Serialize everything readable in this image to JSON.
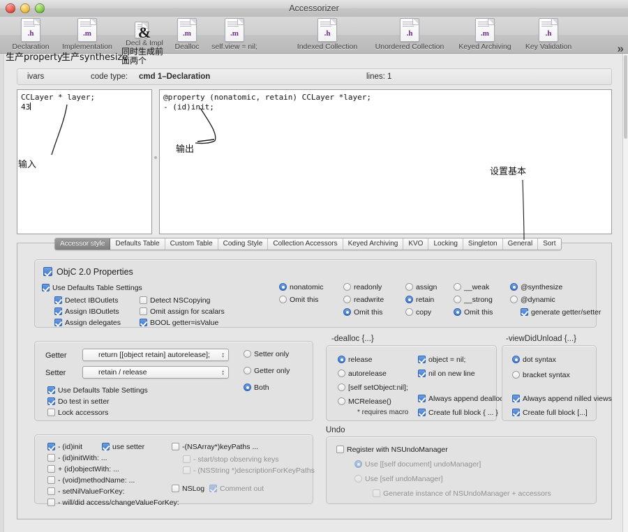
{
  "window": {
    "title": "Accessorizer",
    "traffic_lights": [
      "close",
      "minimize",
      "zoom"
    ]
  },
  "toolbar": {
    "overflow_label": "»",
    "items": [
      {
        "label": "Declaration",
        "icon": "h-file-icon",
        "ext": ".h"
      },
      {
        "label": "Implementation",
        "icon": "m-file-icon",
        "ext": ".m"
      },
      {
        "label": "Decl & Impl",
        "icon": "decl-impl-icon",
        "ext": "&"
      },
      {
        "label": "Dealloc",
        "icon": "m-file-icon",
        "ext": ".m"
      },
      {
        "label": "self.view = nil;",
        "icon": "m-file-icon",
        "ext": ".m"
      },
      {
        "label": "Indexed Collection",
        "icon": "h-file-icon",
        "ext": ".h"
      },
      {
        "label": "Unordered Collection",
        "icon": "h-file-icon",
        "ext": ".h"
      },
      {
        "label": "Keyed Archiving",
        "icon": "m-file-icon",
        "ext": ".m"
      },
      {
        "label": "Key Validation",
        "icon": "h-file-icon",
        "ext": ".h"
      }
    ]
  },
  "annotations": [
    {
      "text": "生产property"
    },
    {
      "text": "生产synthesize"
    },
    {
      "text": "同时生成前\n面两个"
    },
    {
      "text": "输入"
    },
    {
      "text": "输出"
    },
    {
      "text": "设置基本"
    }
  ],
  "infobar": {
    "ivars": "ivars",
    "code_type_label": "code type:",
    "code_type_value": "cmd 1–Declaration",
    "lines": "lines:  1"
  },
  "editors": {
    "input": "CCLayer * layer;\n43",
    "output": "@property (nonatomic, retain) CCLayer *layer;\n- (id)init;"
  },
  "tabs": [
    {
      "label": "Accessor style",
      "selected": true
    },
    {
      "label": "Defaults Table",
      "selected": false
    },
    {
      "label": "Custom Table",
      "selected": false
    },
    {
      "label": "Coding Style",
      "selected": false
    },
    {
      "label": "Collection Accessors",
      "selected": false
    },
    {
      "label": "Keyed Archiving",
      "selected": false
    },
    {
      "label": "KVO",
      "selected": false
    },
    {
      "label": "Locking",
      "selected": false
    },
    {
      "label": "Singleton",
      "selected": false
    },
    {
      "label": "General",
      "selected": false
    },
    {
      "label": "Sort",
      "selected": false
    }
  ],
  "properties": {
    "title": "ObjC 2.0 Properties",
    "title_checked": true,
    "use_defaults": {
      "label": "Use Defaults Table Settings",
      "checked": true
    },
    "col1": [
      {
        "label": "Detect IBOutlets",
        "checked": true
      },
      {
        "label": "Assign IBOutlets",
        "checked": true
      },
      {
        "label": "Assign delegates",
        "checked": true
      }
    ],
    "col2": [
      {
        "label": "Detect NSCopying",
        "checked": false
      },
      {
        "label": "Omit assign for scalars",
        "checked": false
      },
      {
        "label": "BOOL  getter=isValue",
        "checked": true
      }
    ],
    "atomicity": [
      {
        "label": "nonatomic",
        "selected": true
      },
      {
        "label": "Omit this",
        "selected": false
      }
    ],
    "access": [
      {
        "label": "readonly",
        "selected": false
      },
      {
        "label": "readwrite",
        "selected": false
      },
      {
        "label": "Omit this",
        "selected": true
      }
    ],
    "memory": [
      {
        "label": "assign",
        "selected": false
      },
      {
        "label": "retain",
        "selected": true
      },
      {
        "label": "copy",
        "selected": false
      }
    ],
    "arc": [
      {
        "label": "__weak",
        "selected": false
      },
      {
        "label": "__strong",
        "selected": false
      },
      {
        "label": "Omit this",
        "selected": true
      }
    ],
    "synth": [
      {
        "label": "@synthesize",
        "selected": true
      },
      {
        "label": "@dynamic",
        "selected": false
      }
    ],
    "generate_getter_setter": {
      "label": "generate getter/setter",
      "checked": true
    }
  },
  "accessors": {
    "getter_label": "Getter",
    "getter_value": "return [[object retain] autorelease];",
    "setter_label": "Setter",
    "setter_value": "retain   / release",
    "checks": [
      {
        "label": "Use Defaults Table Settings",
        "checked": true
      },
      {
        "label": "Do test in setter",
        "checked": true
      },
      {
        "label": "Lock accessors",
        "checked": false
      }
    ],
    "scope": [
      {
        "label": "Setter only",
        "selected": false
      },
      {
        "label": "Getter only",
        "selected": false
      },
      {
        "label": "Both",
        "selected": true
      }
    ]
  },
  "dealloc": {
    "title": "-dealloc {...}",
    "radios": [
      {
        "label": "release",
        "selected": true
      },
      {
        "label": "autorelease",
        "selected": false
      },
      {
        "label": "[self setObject:nil];",
        "selected": false
      },
      {
        "label": "MCRelease()",
        "selected": false
      }
    ],
    "footnote": "* requires macro",
    "checks": [
      {
        "label": "object = nil;",
        "checked": true
      },
      {
        "label": "nil on new line",
        "checked": true
      },
      {
        "label": "Always append dealloc",
        "checked": true
      },
      {
        "label": "Create full block { ... }",
        "checked": true
      }
    ]
  },
  "viewdidunload": {
    "title": "-viewDidUnload {...}",
    "radios": [
      {
        "label": "dot syntax",
        "selected": true
      },
      {
        "label": "bracket syntax",
        "selected": false
      }
    ],
    "checks": [
      {
        "label": "Always append nilled views",
        "checked": true
      },
      {
        "label": "Create full block [...]",
        "checked": true
      }
    ]
  },
  "methods": {
    "col1": [
      {
        "label": "- (id)init",
        "checked": true
      },
      {
        "label": "- (id)initWith: ...",
        "checked": false
      },
      {
        "label": "+ (id)objectWith: ...",
        "checked": false
      },
      {
        "label": "- (void)methodName: ...",
        "checked": false
      },
      {
        "label": "- setNilValueForKey:",
        "checked": false
      },
      {
        "label": "- will/did access/changeValueForKey:",
        "checked": false
      }
    ],
    "use_setter": {
      "label": "use setter",
      "checked": true
    },
    "col2": [
      {
        "label": "-(NSArray*)keyPaths ...",
        "checked": false,
        "dim": false
      },
      {
        "label": "- start/stop observing keys",
        "checked": false,
        "dim": true
      },
      {
        "label": "- (NSString *)descriptionForKeyPaths",
        "checked": false,
        "dim": true
      }
    ],
    "nslog": {
      "label": "NSLog",
      "checked": false
    },
    "comment_out": {
      "label": "Comment out",
      "checked": true,
      "dim": true
    }
  },
  "undo": {
    "title": "Undo",
    "register": {
      "label": "Register with NSUndoManager",
      "checked": false
    },
    "radios": [
      {
        "label": "Use [[self document] undoManager]",
        "selected": true,
        "dim": true
      },
      {
        "label": "Use [self undoManager]",
        "selected": false,
        "dim": true
      }
    ],
    "generate": {
      "label": "Generate instance of NSUndoManager + accessors",
      "checked": false,
      "dim": true
    }
  }
}
